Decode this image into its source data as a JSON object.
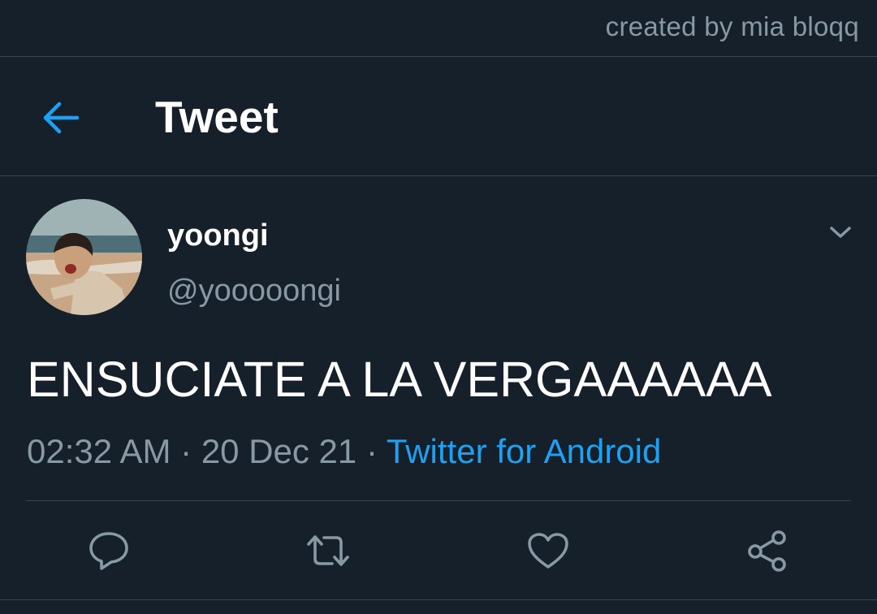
{
  "watermark": "created by mia bloqq",
  "header": {
    "title": "Tweet",
    "back_icon": "arrow-left-icon"
  },
  "tweet": {
    "author": {
      "display_name": "yoongi",
      "handle": "@yooooongi",
      "avatar": "profile-photo"
    },
    "text": "ENSUCIATE A LA VERGAAAAAA",
    "time": "02:32 AM",
    "date": "20 Dec 21",
    "separator": "·",
    "source": "Twitter for Android",
    "menu_icon": "chevron-down-icon"
  },
  "actions": [
    {
      "icon": "reply-icon"
    },
    {
      "icon": "retweet-icon"
    },
    {
      "icon": "like-icon"
    },
    {
      "icon": "share-icon"
    }
  ],
  "colors": {
    "background": "#15202b",
    "accent": "#1da1f2",
    "secondary_text": "#8899a6",
    "divider": "#38444d"
  }
}
